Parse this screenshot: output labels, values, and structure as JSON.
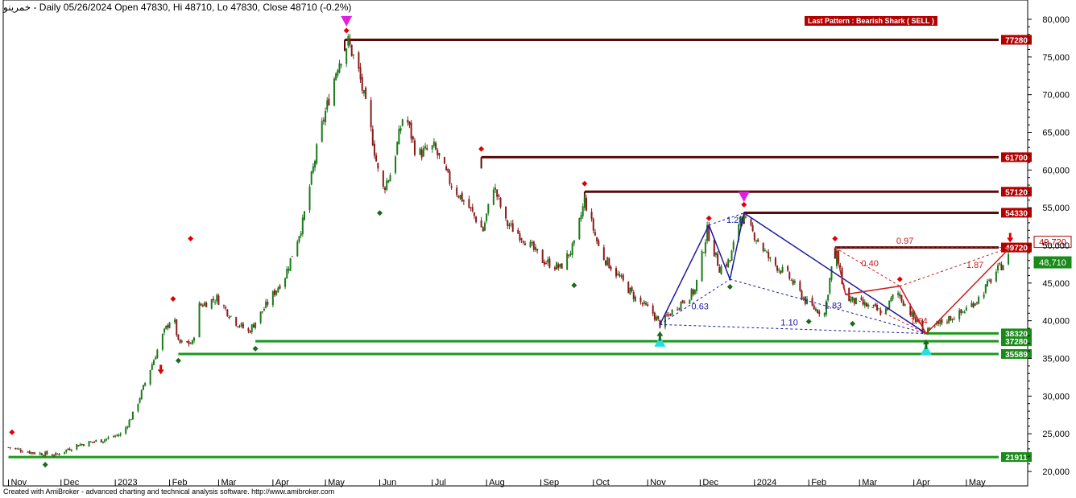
{
  "header": {
    "symbol": "خمرینو",
    "summary": " - Daily 05/26/2024 Open 47830, Hi 48710, Lo 47830, Close 48710 (-0.2%)"
  },
  "footer": {
    "credit": "Created with AmiBroker - advanced charting and technical analysis software. http://www.amibroker.com"
  },
  "pattern_label": "Last Pattern : Bearish Shark ( SELL )",
  "colors": {
    "up": "#1a7a1a",
    "down": "#8b1a1a",
    "resistance": "#5a0a0a",
    "support": "#1a9a1a",
    "pattern_blue": "#1a1aa0",
    "pattern_red": "#cc1a1a",
    "marker_red": "#e00000",
    "marker_green": "#1a6a1a",
    "magenta": "#e020e0",
    "cyan": "#20e0e0",
    "label_red": "#b30000",
    "label_green": "#1a8a1a"
  },
  "chart_data": {
    "type": "candlestick",
    "title": "",
    "xlabel": "",
    "ylabel": "",
    "ylim": [
      19000,
      82000
    ],
    "y_ticks": [
      "20,000",
      "25,000",
      "30,000",
      "35,000",
      "40,000",
      "45,000",
      "50,000",
      "55,000",
      "60,000",
      "65,000",
      "70,000",
      "75,000",
      "80,000"
    ],
    "x_ticks": [
      "Nov",
      "Dec",
      "2023",
      "Feb",
      "Mar",
      "Apr",
      "May",
      "Jun",
      "Jul",
      "Aug",
      "Sep",
      "Oct",
      "Nov",
      "Dec",
      "2024",
      "Feb",
      "Mar",
      "Apr",
      "May"
    ],
    "close_path": [
      [
        "2022-11-01",
        23200
      ],
      [
        "2022-11-15",
        22500
      ],
      [
        "2022-11-28",
        22200
      ],
      [
        "2022-12-10",
        23500
      ],
      [
        "2022-12-25",
        24200
      ],
      [
        "2023-01-05",
        25000
      ],
      [
        "2023-01-12",
        28000
      ],
      [
        "2023-01-20",
        33000
      ],
      [
        "2023-01-28",
        38000
      ],
      [
        "2023-02-03",
        41000
      ],
      [
        "2023-02-06",
        37000
      ],
      [
        "2023-02-14",
        37000
      ],
      [
        "2023-02-18",
        42000
      ],
      [
        "2023-02-28",
        43000
      ],
      [
        "2023-03-10",
        40000
      ],
      [
        "2023-03-18",
        38500
      ],
      [
        "2023-03-28",
        42000
      ],
      [
        "2023-04-08",
        46000
      ],
      [
        "2023-04-18",
        53000
      ],
      [
        "2023-04-28",
        65000
      ],
      [
        "2023-05-08",
        74000
      ],
      [
        "2023-05-14",
        77000
      ],
      [
        "2023-05-20",
        73000
      ],
      [
        "2023-05-28",
        64000
      ],
      [
        "2023-06-02",
        57000
      ],
      [
        "2023-06-08",
        60000
      ],
      [
        "2023-06-15",
        68000
      ],
      [
        "2023-06-22",
        62000
      ],
      [
        "2023-07-02",
        63000
      ],
      [
        "2023-07-12",
        58000
      ],
      [
        "2023-07-22",
        55000
      ],
      [
        "2023-07-30",
        52000
      ],
      [
        "2023-08-05",
        58000
      ],
      [
        "2023-08-12",
        53000
      ],
      [
        "2023-08-22",
        51000
      ],
      [
        "2023-09-02",
        48000
      ],
      [
        "2023-09-12",
        47000
      ],
      [
        "2023-09-20",
        50000
      ],
      [
        "2023-09-26",
        56000
      ],
      [
        "2023-10-05",
        49000
      ],
      [
        "2023-10-15",
        46000
      ],
      [
        "2023-10-25",
        43000
      ],
      [
        "2023-11-04",
        41000
      ],
      [
        "2023-11-08",
        39500
      ],
      [
        "2023-11-18",
        42000
      ],
      [
        "2023-11-28",
        44000
      ],
      [
        "2023-12-05",
        52000
      ],
      [
        "2023-12-12",
        47000
      ],
      [
        "2023-12-18",
        48000
      ],
      [
        "2023-12-24",
        54000
      ],
      [
        "2024-01-02",
        51000
      ],
      [
        "2024-01-10",
        48000
      ],
      [
        "2024-01-20",
        46000
      ],
      [
        "2024-02-01",
        42000
      ],
      [
        "2024-02-10",
        41000
      ],
      [
        "2024-02-16",
        50000
      ],
      [
        "2024-02-22",
        43000
      ],
      [
        "2024-03-05",
        42000
      ],
      [
        "2024-03-15",
        41000
      ],
      [
        "2024-03-22",
        44000
      ],
      [
        "2024-04-02",
        40000
      ],
      [
        "2024-04-08",
        38300
      ],
      [
        "2024-04-18",
        40000
      ],
      [
        "2024-04-28",
        41000
      ],
      [
        "2024-05-08",
        43000
      ],
      [
        "2024-05-18",
        46500
      ],
      [
        "2024-05-26",
        48710
      ]
    ],
    "levels": [
      {
        "value": 77280,
        "label": "77280",
        "start": "2023-05-12",
        "kind": "resistance"
      },
      {
        "value": 61700,
        "label": "61700",
        "start": "2023-07-29",
        "kind": "resistance"
      },
      {
        "value": 57120,
        "label": "57120",
        "start": "2023-09-26",
        "kind": "resistance"
      },
      {
        "value": 54330,
        "label": "54330",
        "start": "2023-12-26",
        "kind": "resistance"
      },
      {
        "value": 49720,
        "label": "49720",
        "start": "2024-02-16",
        "kind": "resistance"
      },
      {
        "value": 38320,
        "label": "38320",
        "start": "2024-04-08",
        "kind": "support"
      },
      {
        "value": 37280,
        "label": "37280",
        "start": "2023-03-22",
        "kind": "support"
      },
      {
        "value": 35589,
        "label": "35589",
        "start": "2023-02-06",
        "kind": "support"
      },
      {
        "value": 21911,
        "label": "21911",
        "start": "2022-11-01",
        "kind": "support"
      }
    ],
    "price_labels": [
      {
        "value": 49720,
        "text": "49,720",
        "kind": "red"
      },
      {
        "value": 48710,
        "text": "48,710",
        "kind": "green"
      }
    ],
    "pattern_blue": [
      [
        "2023-11-08",
        39500
      ],
      [
        "2023-12-06",
        52700
      ],
      [
        "2023-12-18",
        45500
      ],
      [
        "2023-12-26",
        54300
      ],
      [
        "2024-04-08",
        38300
      ]
    ],
    "pattern_red": [
      [
        "2024-02-16",
        49700
      ],
      [
        "2024-02-22",
        43500
      ],
      [
        "2024-03-24",
        44600
      ],
      [
        "2024-04-08",
        38300
      ],
      [
        "2024-05-26",
        49720
      ]
    ],
    "ratio_labels": [
      {
        "text": "0.63",
        "x": "2023-11-26",
        "y": 41500,
        "color": "blue"
      },
      {
        "text": "1.28",
        "x": "2023-12-16",
        "y": 53000,
        "color": "blue"
      },
      {
        "text": "1.10",
        "x": "2024-01-16",
        "y": 39400,
        "color": "blue"
      },
      {
        "text": "1.83",
        "x": "2024-02-10",
        "y": 41600,
        "color": "blue"
      },
      {
        "text": "0.97",
        "x": "2024-03-22",
        "y": 50200,
        "color": "red"
      },
      {
        "text": "0.40",
        "x": "2024-03-02",
        "y": 47200,
        "color": "red"
      },
      {
        "text": "1.64",
        "x": "2024-03-30",
        "y": 39600,
        "color": "red"
      },
      {
        "text": "1.87",
        "x": "2024-05-01",
        "y": 47000,
        "color": "red"
      }
    ],
    "markers": [
      {
        "type": "diamond-red",
        "x": "2022-11-03",
        "y": 25200
      },
      {
        "type": "diamond-green",
        "x": "2022-11-22",
        "y": 20900
      },
      {
        "type": "arrow-red",
        "x": "2023-01-27",
        "y": 33200
      },
      {
        "type": "diamond-red",
        "x": "2023-02-03",
        "y": 42900
      },
      {
        "type": "diamond-green",
        "x": "2023-02-06",
        "y": 34700
      },
      {
        "type": "diamond-red",
        "x": "2023-02-13",
        "y": 50900
      },
      {
        "type": "diamond-green",
        "x": "2023-03-22",
        "y": 36300
      },
      {
        "type": "triangle-magenta",
        "x": "2023-05-13",
        "y": 79800
      },
      {
        "type": "diamond-red",
        "x": "2023-05-13",
        "y": 78500
      },
      {
        "type": "diamond-green",
        "x": "2023-06-01",
        "y": 54300
      },
      {
        "type": "diamond-red",
        "x": "2023-07-29",
        "y": 62800
      },
      {
        "type": "diamond-red",
        "x": "2023-09-26",
        "y": 58200
      },
      {
        "type": "diamond-green",
        "x": "2023-09-20",
        "y": 44700
      },
      {
        "type": "triangle-cyan",
        "x": "2023-11-08",
        "y": 37200
      },
      {
        "type": "arrow-green",
        "x": "2023-11-08",
        "y": 38300
      },
      {
        "type": "diamond-red",
        "x": "2023-12-06",
        "y": 53600
      },
      {
        "type": "diamond-green",
        "x": "2023-12-18",
        "y": 44500
      },
      {
        "type": "triangle-magenta",
        "x": "2023-12-26",
        "y": 56500
      },
      {
        "type": "diamond-red",
        "x": "2023-12-26",
        "y": 55400
      },
      {
        "type": "diamond-green",
        "x": "2024-02-01",
        "y": 39900
      },
      {
        "type": "diamond-red",
        "x": "2024-02-16",
        "y": 50900
      },
      {
        "type": "diamond-green",
        "x": "2024-02-26",
        "y": 39600
      },
      {
        "type": "diamond-red",
        "x": "2024-03-24",
        "y": 45500
      },
      {
        "type": "triangle-cyan",
        "x": "2024-04-08",
        "y": 36100
      },
      {
        "type": "arrow-green",
        "x": "2024-04-08",
        "y": 37200
      },
      {
        "type": "arrow-red",
        "x": "2024-05-26",
        "y": 50700
      }
    ]
  }
}
